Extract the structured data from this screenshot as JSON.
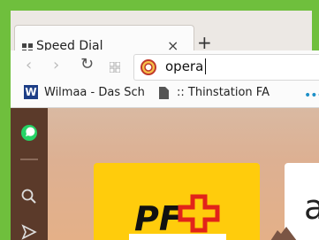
{
  "tab": {
    "title": "Speed Dial",
    "close_glyph": "×"
  },
  "new_tab_glyph": "+",
  "toolbar": {
    "back_glyph": "‹",
    "forward_glyph": "›",
    "reload_glyph": "↻",
    "url_value": "opera"
  },
  "bookmarks": [
    {
      "label": "Wilmaa - Das Sch",
      "icon": "w-logo-icon"
    },
    {
      "label": ":: Thinstation FA",
      "icon": "document-icon"
    }
  ],
  "bookmarks_more_glyph": "•••",
  "sidebar": {
    "icons": [
      "whatsapp-icon",
      "search-icon",
      "send-icon"
    ]
  },
  "speed_dial": {
    "tile1_logo": "PF",
    "tile2_text": "a"
  },
  "colors": {
    "accent_green": "#6fbf3d",
    "sidebar_brown": "#5b3a2a",
    "tile_yellow": "#ffcc0c",
    "pf_red": "#e2231a"
  }
}
